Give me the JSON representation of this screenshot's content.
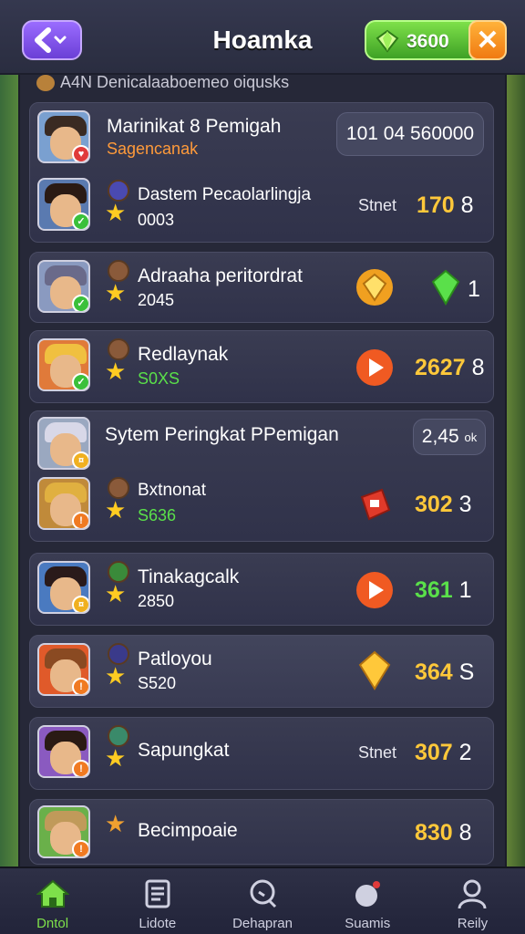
{
  "header": {
    "title": "Hoamka",
    "gem_value": "3600",
    "close_label": "✕"
  },
  "subheader": "A4N Denicalaaboemeo oiqusks",
  "featured": {
    "title": "Marinikat 8 Pemigah",
    "subtitle": "Sagencanak",
    "value": "101 04 560000"
  },
  "rows": [
    {
      "name": "Dastem Pecaolarlingja",
      "sub": "0003",
      "label": "Stnet",
      "score": "170",
      "score_tail": "8"
    },
    {
      "name": "Adraaha peritordrat",
      "sub": "2045",
      "score": "1"
    },
    {
      "name": "Redlaynak",
      "sub": "S0XS",
      "score": "2627",
      "score_tail": "8"
    },
    {
      "name": "Bxtnonat",
      "sub": "S636",
      "score": "302",
      "score_tail": "3"
    },
    {
      "name": "Tinakagcalk",
      "sub": "2850",
      "score": "361",
      "score_tail": "1"
    },
    {
      "name": "Patloyou",
      "sub": "S520",
      "score": "364",
      "score_tail": "S"
    },
    {
      "name": "Sapungkat",
      "label": "Stnet",
      "score": "307",
      "score_tail": "2"
    },
    {
      "name": "Becimpoaie",
      "score": "830",
      "score_tail": "8"
    }
  ],
  "system_card": {
    "title": "Sytem Peringkat PPemigan",
    "value": "2,45",
    "value_tail": "ok"
  },
  "nav": [
    {
      "label": "Dntol"
    },
    {
      "label": "Lidote"
    },
    {
      "label": "Dehapran"
    },
    {
      "label": "Suamis"
    },
    {
      "label": "Reily"
    }
  ],
  "colors": {
    "gold": "#ffc83a",
    "green": "#5ae04a",
    "orange": "#f07a22"
  }
}
